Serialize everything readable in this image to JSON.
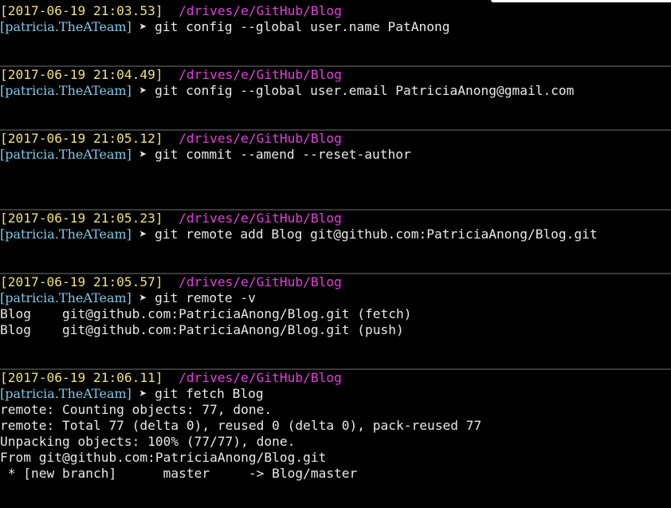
{
  "entries": [
    {
      "timestamp": "[2017-06-19 21:03.53]",
      "path": "/drives/e/GitHub/Blog",
      "user": "[patricia.TheATeam]",
      "arrow": "➤",
      "command": "git config --global user.name PatAnong",
      "output": []
    },
    {
      "timestamp": "[2017-06-19 21:04.49]",
      "path": "/drives/e/GitHub/Blog",
      "user": "[patricia.TheATeam]",
      "arrow": "➤",
      "command": "git config --global user.email PatriciaAnong@gmail.com",
      "output": []
    },
    {
      "timestamp": "[2017-06-19 21:05.12]",
      "path": "/drives/e/GitHub/Blog",
      "user": "[patricia.TheATeam]",
      "arrow": "➤",
      "command": "git commit --amend --reset-author",
      "output": []
    },
    {
      "timestamp": "[2017-06-19 21:05.23]",
      "path": "/drives/e/GitHub/Blog",
      "user": "[patricia.TheATeam]",
      "arrow": "➤",
      "command": "git remote add Blog git@github.com:PatriciaAnong/Blog.git",
      "output": []
    },
    {
      "timestamp": "[2017-06-19 21:05.57]",
      "path": "/drives/e/GitHub/Blog",
      "user": "[patricia.TheATeam]",
      "arrow": "➤",
      "command": "git remote -v",
      "output": [
        "Blog    git@github.com:PatriciaAnong/Blog.git (fetch)",
        "Blog    git@github.com:PatriciaAnong/Blog.git (push)"
      ]
    },
    {
      "timestamp": "[2017-06-19 21:06.11]",
      "path": "/drives/e/GitHub/Blog",
      "user": "[patricia.TheATeam]",
      "arrow": "➤",
      "command": "git fetch Blog",
      "output": [
        "remote: Counting objects: 77, done.",
        "remote: Total 77 (delta 0), reused 0 (delta 0), pack-reused 77",
        "Unpacking objects: 100% (77/77), done.",
        "From git@github.com:PatriciaAnong/Blog.git",
        " * [new branch]      master     -> Blog/master"
      ]
    }
  ],
  "colors": {
    "background": "#000000",
    "timestamp": "#f0e27a",
    "path": "#e040d8",
    "user": "#7ec8e8",
    "text": "#e8e8e8",
    "separator": "#3a3a3a"
  }
}
